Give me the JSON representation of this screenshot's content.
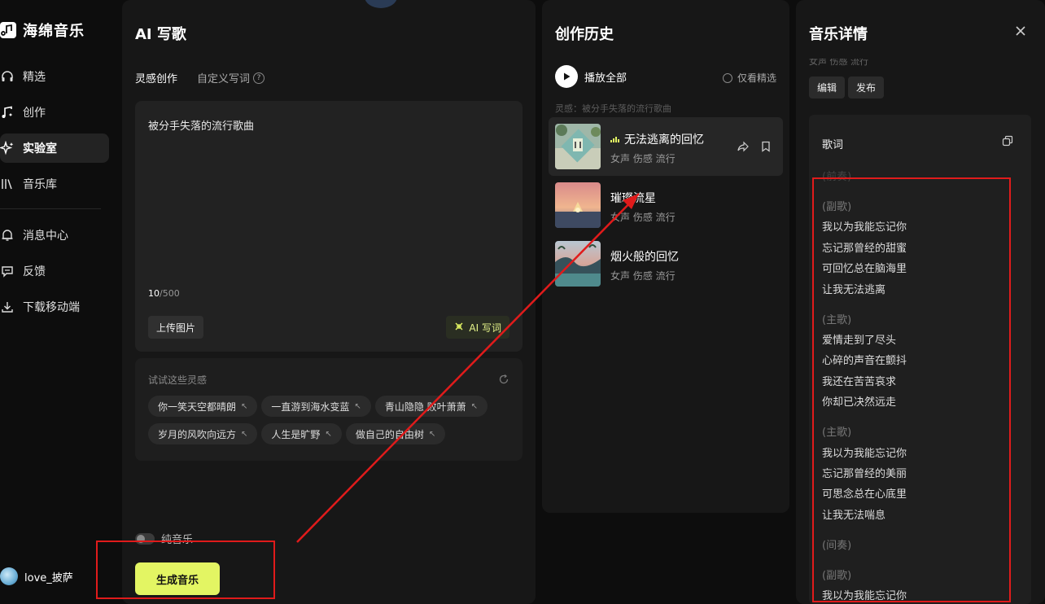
{
  "app": {
    "name": "海绵音乐"
  },
  "sidebar": {
    "items": [
      {
        "label": "精选",
        "icon": "headphones-icon"
      },
      {
        "label": "创作",
        "icon": "music-note-icon"
      },
      {
        "label": "实验室",
        "icon": "sparkle-icon",
        "active": true
      },
      {
        "label": "音乐库",
        "icon": "library-icon"
      }
    ],
    "items2": [
      {
        "label": "消息中心",
        "icon": "bell-icon"
      },
      {
        "label": "反馈",
        "icon": "feedback-icon"
      },
      {
        "label": "下载移动端",
        "icon": "download-icon"
      }
    ],
    "user": {
      "name": "love_披萨"
    }
  },
  "ai_panel": {
    "title": "AI 写歌",
    "tab_active": "灵感创作",
    "tab_inactive": "自定义写词",
    "help": "?",
    "prompt": "被分手失落的流行歌曲",
    "counter_current": "10",
    "counter_max": "/500",
    "upload_label": "上传图片",
    "ai_write_label": "AI 写词",
    "inspire_title": "试试这些灵感",
    "chips": [
      "你一笑天空都晴朗",
      "一直游到海水变蓝",
      "青山隐隐 败叶萧萧",
      "岁月的风吹向远方",
      "人生是旷野",
      "做自己的自由树"
    ],
    "chip_arrow": "↖",
    "pure_music_label": "纯音乐",
    "generate_label": "生成音乐"
  },
  "history": {
    "title": "创作历史",
    "play_all": "播放全部",
    "only_pick": "仅看精选",
    "hint": "灵感：被分手失落的流行歌曲",
    "songs": [
      {
        "title": "无法逃离的回忆",
        "tags": "女声 伤感 流行",
        "playing": true
      },
      {
        "title": "璀璨流星",
        "tags": "女声 伤感 流行"
      },
      {
        "title": "烟火般的回忆",
        "tags": "女声 伤感 流行"
      }
    ]
  },
  "detail": {
    "title": "音乐详情",
    "subtitle": "女声 伤感 流行",
    "edit_label": "编辑",
    "publish_label": "发布",
    "lyrics_title": "歌词",
    "lyrics": [
      {
        "faded": true,
        "lines": [
          "(前奏)"
        ]
      },
      {
        "section": "(副歌)",
        "lines": [
          "我以为我能忘记你",
          "忘记那曾经的甜蜜",
          "可回忆总在脑海里",
          "让我无法逃离"
        ]
      },
      {
        "section": "(主歌)",
        "lines": [
          "爱情走到了尽头",
          "心碎的声音在颤抖",
          "我还在苦苦哀求",
          "你却已决然远走"
        ]
      },
      {
        "section": "(主歌)",
        "lines": [
          "我以为我能忘记你",
          "忘记那曾经的美丽",
          "可思念总在心底里",
          "让我无法喘息"
        ]
      },
      {
        "section": "(间奏)",
        "lines": []
      },
      {
        "section": "(副歌)",
        "lines": [
          "我以为我能忘记你"
        ]
      }
    ]
  },
  "colors": {
    "accent": "#e3f563",
    "annotation": "#e01b1b"
  }
}
